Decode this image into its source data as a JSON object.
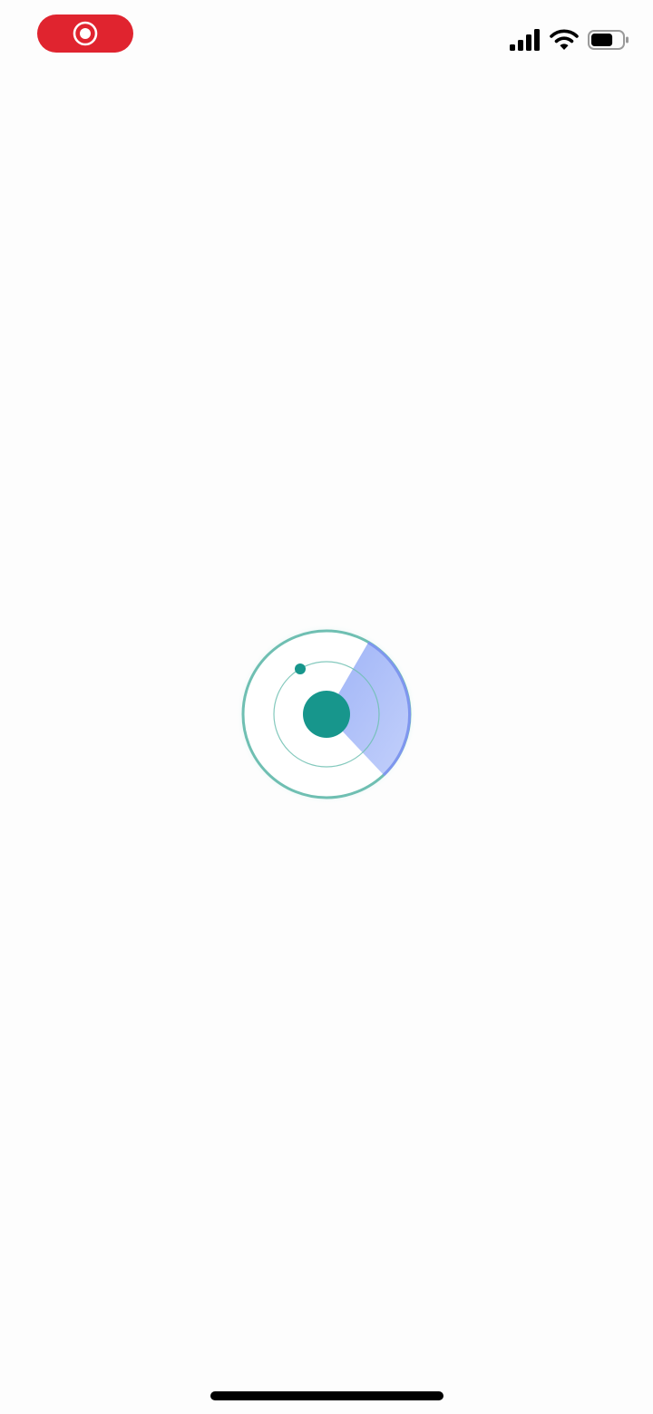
{
  "colors": {
    "record_red": "#e0242f",
    "teal": "#17968c",
    "teal_ring": "#6fbfb2",
    "sweep_blue": "#9ab0f7",
    "sweep_edge": "#7f96ef",
    "glow": "#d8f1ef",
    "icon_black": "#000000",
    "home_indicator": "#000000"
  },
  "status_bar": {
    "record_icon": "screen-record-icon",
    "signal_icon": "cellular-signal-icon",
    "wifi_icon": "wifi-icon",
    "battery_icon": "battery-icon",
    "battery_level": 0.7
  },
  "loader": {
    "icon": "radar-loading-icon"
  }
}
